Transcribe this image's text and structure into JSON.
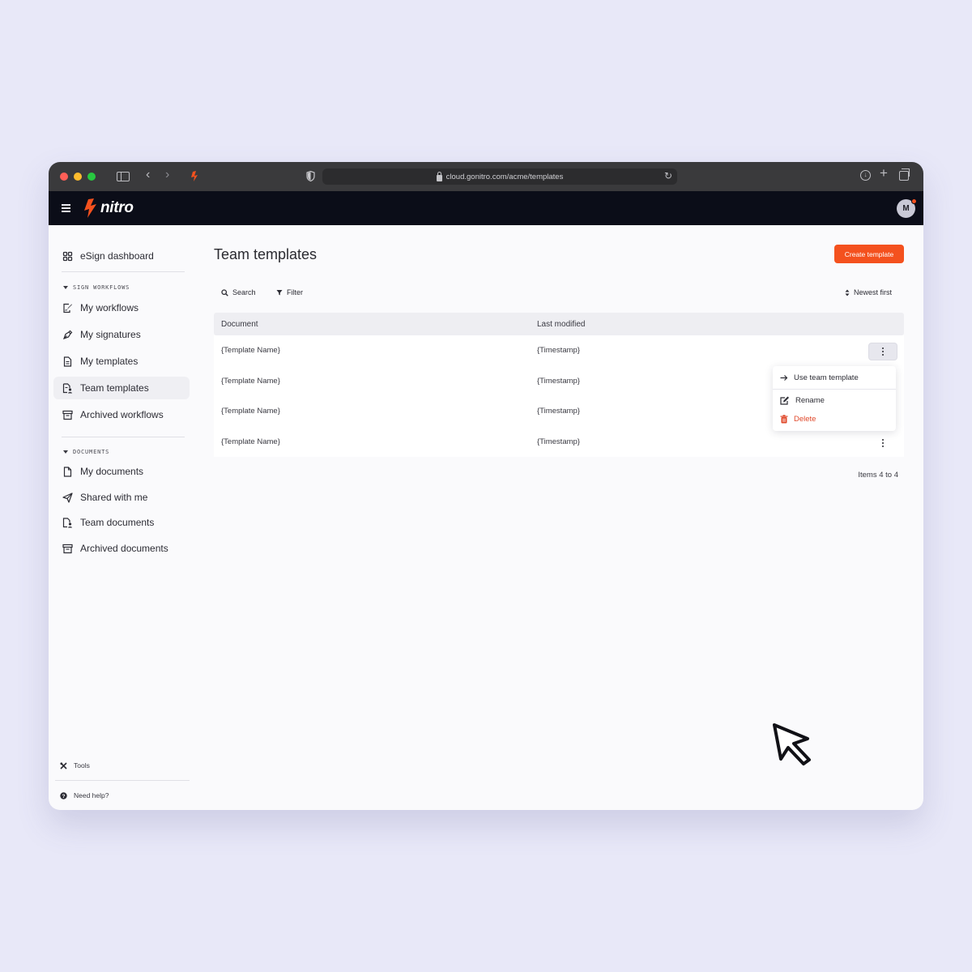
{
  "browser": {
    "url": "cloud.gonitro.com/acme/templates"
  },
  "app": {
    "logo_text": "nitro",
    "avatar_initial": "M",
    "brand_color": "#f4511e"
  },
  "sidebar": {
    "dashboard": "eSign dashboard",
    "sign_workflows_title": "SIGN WORKFLOWS",
    "sign_items": [
      {
        "label": "My workflows",
        "icon": "signature-edit-icon"
      },
      {
        "label": "My signatures",
        "icon": "pen-nib-icon"
      },
      {
        "label": "My templates",
        "icon": "template-file-icon"
      },
      {
        "label": "Team templates",
        "icon": "team-template-icon",
        "active": true
      },
      {
        "label": "Archived workflows",
        "icon": "archive-box-icon"
      }
    ],
    "documents_title": "DOCUMENTS",
    "document_items": [
      {
        "label": "My documents",
        "icon": "document-icon"
      },
      {
        "label": "Shared with me",
        "icon": "send-icon"
      },
      {
        "label": "Team documents",
        "icon": "team-document-icon"
      },
      {
        "label": "Archived documents",
        "icon": "archive-box-icon"
      }
    ],
    "tools": "Tools",
    "help": "Need help?"
  },
  "main": {
    "title": "Team templates",
    "create_button": "Create template",
    "search_label": "Search",
    "filter_label": "Filter",
    "sort_label": "Newest first",
    "columns": [
      "Document",
      "Last modified"
    ],
    "rows": [
      {
        "document": "{Template Name}",
        "modified": "{Timestamp}"
      },
      {
        "document": "{Template Name}",
        "modified": "{Timestamp}"
      },
      {
        "document": "{Template Name}",
        "modified": "{Timestamp}"
      },
      {
        "document": "{Template Name}",
        "modified": "{Timestamp}"
      }
    ],
    "row_menu": {
      "use": "Use team template",
      "rename": "Rename",
      "delete": "Delete"
    },
    "pagination": "Items 4 to 4"
  }
}
